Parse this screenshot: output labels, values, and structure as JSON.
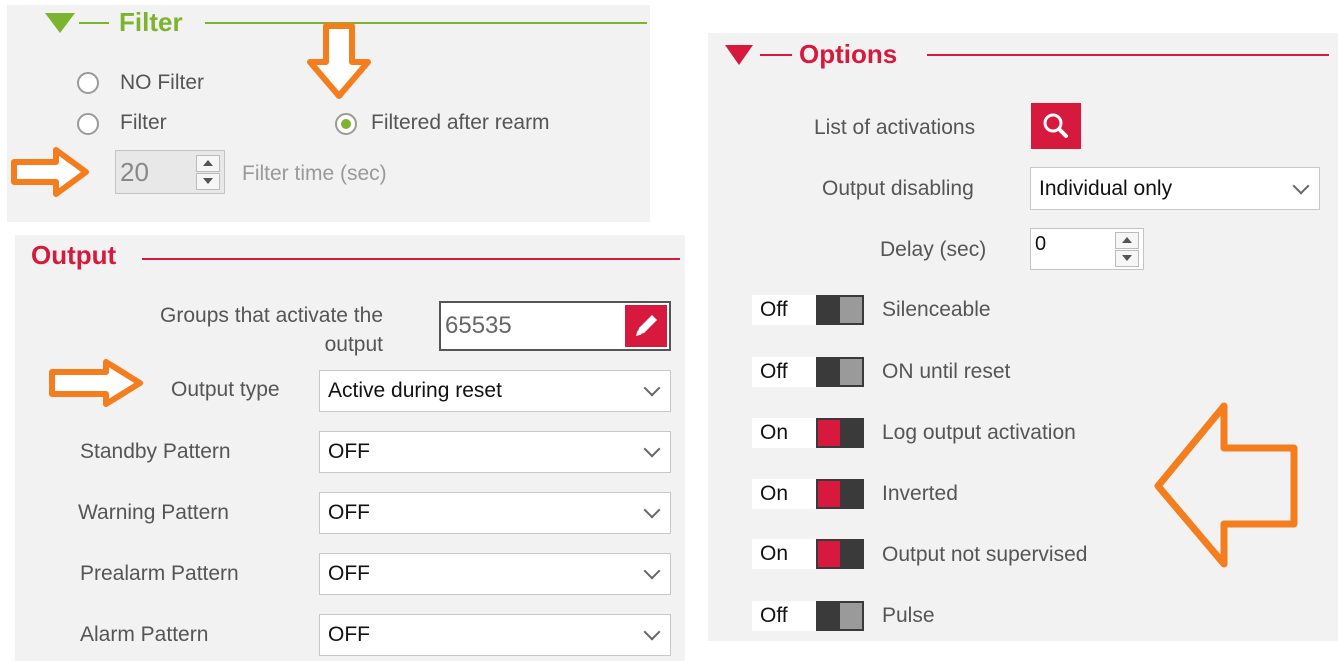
{
  "filter": {
    "title": "Filter",
    "options": [
      "NO Filter",
      "Filter",
      "Filtered after rearm"
    ],
    "selected": "Filtered after rearm",
    "time_value": "20",
    "time_label": "Filter time (sec)"
  },
  "output": {
    "title": "Output",
    "groups_label_line1": "Groups that activate the",
    "groups_label_line2": "output",
    "groups_value": "65535",
    "fields": [
      {
        "label": "Output type",
        "value": "Active during reset"
      },
      {
        "label": "Standby Pattern",
        "value": "OFF"
      },
      {
        "label": "Warning Pattern",
        "value": "OFF"
      },
      {
        "label": "Prealarm Pattern",
        "value": "OFF"
      },
      {
        "label": "Alarm Pattern",
        "value": "OFF"
      }
    ]
  },
  "options": {
    "title": "Options",
    "list_activations_label": "List of activations",
    "output_disabling_label": "Output disabling",
    "output_disabling_value": "Individual only",
    "delay_label": "Delay (sec)",
    "delay_value": "0",
    "toggles": [
      {
        "state": "Off",
        "label": "Silenceable"
      },
      {
        "state": "Off",
        "label": "ON until reset"
      },
      {
        "state": "On",
        "label": "Log output activation"
      },
      {
        "state": "On",
        "label": "Inverted"
      },
      {
        "state": "On",
        "label": "Output not supervised"
      },
      {
        "state": "Off",
        "label": "Pulse"
      }
    ]
  },
  "colors": {
    "filter_accent": "#7cb32f",
    "red_accent": "#d7193d",
    "annotation_orange": "#f47d1e"
  },
  "icons": [
    "triangle-down-icon",
    "magnifier-icon",
    "pencil-icon",
    "chevron-down-icon",
    "arrow-annotation-icon"
  ]
}
